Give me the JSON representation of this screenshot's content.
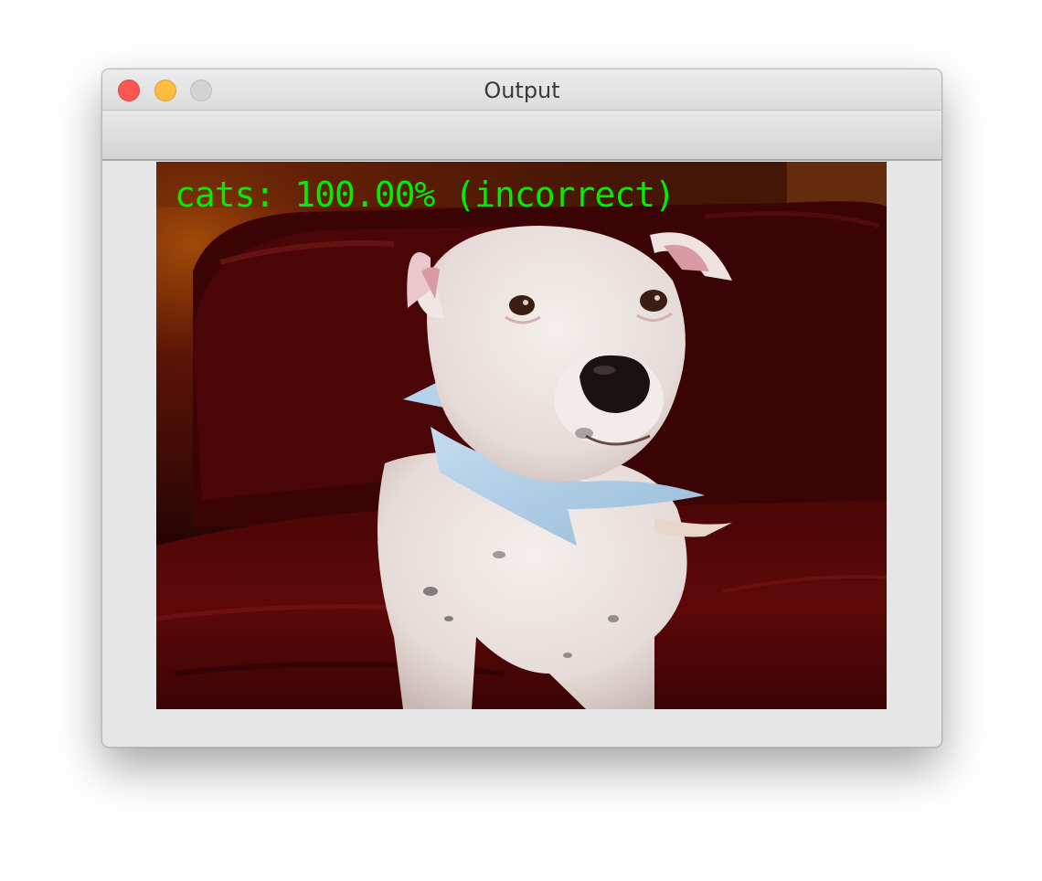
{
  "window": {
    "title": "Output",
    "controls": {
      "close": "close-icon",
      "minimize": "minimize-icon",
      "maximize": "maximize-icon"
    }
  },
  "image": {
    "overlay_text": "cats: 100.00% (incorrect)",
    "overlay_color": "#00ee00"
  }
}
